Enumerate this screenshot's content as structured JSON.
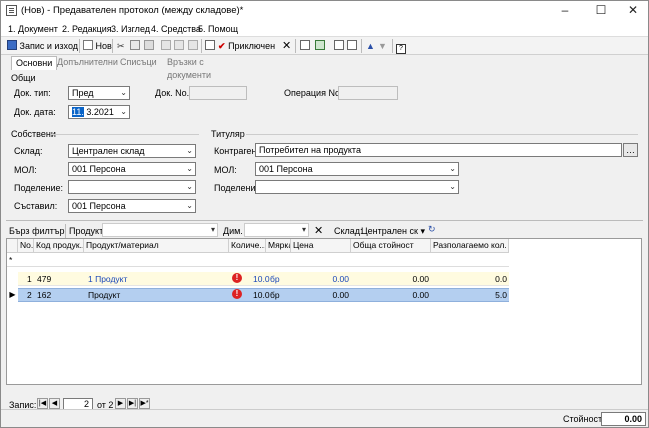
{
  "window": {
    "title": "(Нов) - Предавателен протокол (между складове)*"
  },
  "menu": [
    "1. Документ",
    "2. Редакция",
    "3. Изглед",
    "4. Средства",
    "5. Помощ"
  ],
  "toolbar": {
    "save_exit": "Запис и изход",
    "new": "Нов",
    "accounted": "Приключен"
  },
  "tabs": [
    "Основни",
    "Допълнителни",
    "Списъци",
    "Връзки с документи"
  ],
  "general": {
    "section": "Общи",
    "doc_type_label": "Док. тип:",
    "doc_type_value": "Пред",
    "doc_no_label": "Док. No.",
    "doc_no_value": "",
    "operation_no_label": "Операция No.",
    "operation_no_value": "",
    "doc_date_label": "Док. дата:",
    "doc_date_day": "11.",
    "doc_date_rest": " 3.2021"
  },
  "own": {
    "section": "Собствени",
    "warehouse_label": "Склад:",
    "warehouse_value": "Централен склад",
    "mol_label": "МОЛ:",
    "mol_value": "001 Персона",
    "division_label": "Поделение:",
    "division_value": "",
    "author_label": "Съставил:",
    "author_value": "001 Персона"
  },
  "holder": {
    "section": "Титуляр",
    "partner_label": "Контрагент:",
    "partner_value": "Потребител на продукта",
    "mol_label": "МОЛ:",
    "mol_value": "001 Персона",
    "division_label": "Поделение:",
    "division_value": ""
  },
  "filter": {
    "quick": "Бърз филтър",
    "product_label": "Продукт:",
    "product_value": "",
    "dim_label": "Дим.",
    "dim_value": "",
    "warehouse_label": "Склад:",
    "warehouse_value": "Централен ск"
  },
  "grid": {
    "columns": [
      "No.",
      "Код продук...",
      "Продукт/материал",
      "Количе...",
      "Мярка",
      "Цена",
      "Обща стойност",
      "Разполагаемо кол."
    ],
    "rows": [
      {
        "no": "1",
        "code": "479",
        "product": "1 Продукт",
        "qty": "10.0",
        "unit": "бр",
        "price": "0.00",
        "total": "0.00",
        "available": "0.0"
      },
      {
        "no": "2",
        "code": "162",
        "product": "Продукт",
        "qty": "10.0",
        "unit": "бр",
        "price": "0.00",
        "total": "0.00",
        "available": "5.0"
      }
    ]
  },
  "nav": {
    "label": "Запис:",
    "current": "2",
    "of": "от 2"
  },
  "status": {
    "value_label": "Стойност:",
    "value": "0.00"
  }
}
